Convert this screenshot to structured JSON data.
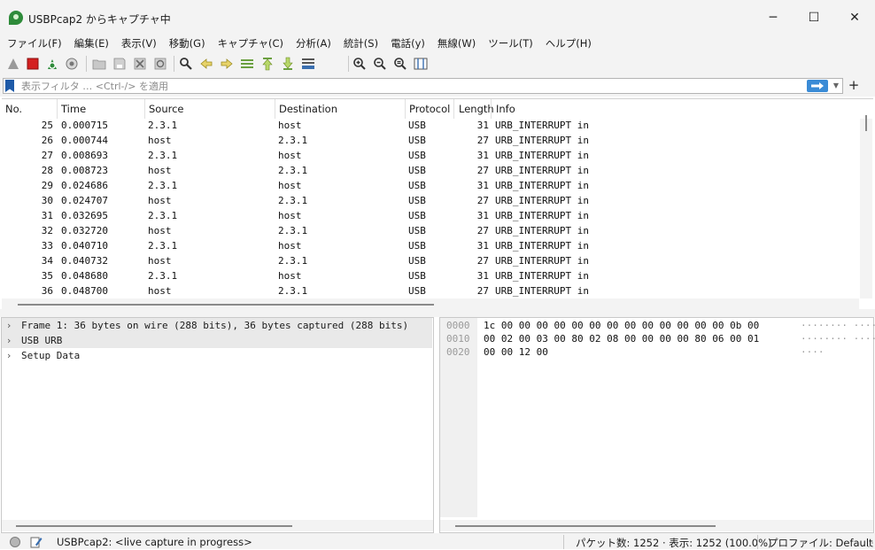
{
  "window": {
    "title": "USBPcap2 からキャプチャ中",
    "controls": {
      "minimize": "─",
      "maximize": "☐",
      "close": "✕"
    }
  },
  "menu": [
    "ファイル(F)",
    "編集(E)",
    "表示(V)",
    "移動(G)",
    "キャプチャ(C)",
    "分析(A)",
    "統計(S)",
    "電話(y)",
    "無線(W)",
    "ツール(T)",
    "ヘルプ(H)"
  ],
  "toolbar_icons": [
    "shark-fin-start-icon",
    "stop-capture-icon",
    "restart-capture-icon",
    "capture-options-icon",
    "open-file-icon",
    "save-file-icon",
    "close-file-icon",
    "reload-file-icon",
    "find-packet-icon",
    "go-back-icon",
    "go-forward-icon",
    "go-to-packet-icon",
    "first-packet-icon",
    "last-packet-icon",
    "autoscroll-icon",
    "colorize-icon",
    "zoom-in-icon",
    "zoom-out-icon",
    "zoom-reset-icon",
    "resize-columns-icon"
  ],
  "filter": {
    "placeholder": "表示フィルタ … <Ctrl-/> を適用",
    "apply_icon": "arrow-right-icon",
    "add_label": "+"
  },
  "packet_list": {
    "columns": [
      "No.",
      "Time",
      "Source",
      "Destination",
      "Protocol",
      "Length",
      "Info"
    ],
    "rows": [
      {
        "no": "25",
        "time": "0.000715",
        "src": "2.3.1",
        "dst": "host",
        "proto": "USB",
        "len": "31",
        "info": "URB_INTERRUPT in"
      },
      {
        "no": "26",
        "time": "0.000744",
        "src": "host",
        "dst": "2.3.1",
        "proto": "USB",
        "len": "27",
        "info": "URB_INTERRUPT in"
      },
      {
        "no": "27",
        "time": "0.008693",
        "src": "2.3.1",
        "dst": "host",
        "proto": "USB",
        "len": "31",
        "info": "URB_INTERRUPT in"
      },
      {
        "no": "28",
        "time": "0.008723",
        "src": "host",
        "dst": "2.3.1",
        "proto": "USB",
        "len": "27",
        "info": "URB_INTERRUPT in"
      },
      {
        "no": "29",
        "time": "0.024686",
        "src": "2.3.1",
        "dst": "host",
        "proto": "USB",
        "len": "31",
        "info": "URB_INTERRUPT in"
      },
      {
        "no": "30",
        "time": "0.024707",
        "src": "host",
        "dst": "2.3.1",
        "proto": "USB",
        "len": "27",
        "info": "URB_INTERRUPT in"
      },
      {
        "no": "31",
        "time": "0.032695",
        "src": "2.3.1",
        "dst": "host",
        "proto": "USB",
        "len": "31",
        "info": "URB_INTERRUPT in"
      },
      {
        "no": "32",
        "time": "0.032720",
        "src": "host",
        "dst": "2.3.1",
        "proto": "USB",
        "len": "27",
        "info": "URB_INTERRUPT in"
      },
      {
        "no": "33",
        "time": "0.040710",
        "src": "2.3.1",
        "dst": "host",
        "proto": "USB",
        "len": "31",
        "info": "URB_INTERRUPT in"
      },
      {
        "no": "34",
        "time": "0.040732",
        "src": "host",
        "dst": "2.3.1",
        "proto": "USB",
        "len": "27",
        "info": "URB_INTERRUPT in"
      },
      {
        "no": "35",
        "time": "0.048680",
        "src": "2.3.1",
        "dst": "host",
        "proto": "USB",
        "len": "31",
        "info": "URB_INTERRUPT in"
      },
      {
        "no": "36",
        "time": "0.048700",
        "src": "host",
        "dst": "2.3.1",
        "proto": "USB",
        "len": "27",
        "info": "URB_INTERRUPT in"
      }
    ]
  },
  "details": [
    "Frame 1: 36 bytes on wire (288 bits), 36 bytes captured (288 bits)",
    "USB URB",
    "Setup Data"
  ],
  "bytes": [
    {
      "offset": "0000",
      "hex": "1c 00 00 00 00 00 00 00  00 00 00 00 00 00 0b 00",
      "ascii": "········ ········"
    },
    {
      "offset": "0010",
      "hex": "00 02 00 03 00 80 02 08  00 00 00 00 80 06 00 01",
      "ascii": "········ ········"
    },
    {
      "offset": "0020",
      "hex": "00 00 12 00",
      "ascii": "····"
    }
  ],
  "status": {
    "capture": "USBPcap2: <live capture in progress>",
    "packets": "パケット数: 1252 · 表示: 1252 (100.0%)",
    "profile": "プロファイル: Default"
  },
  "colors": {
    "chrome": "#f3f3f3",
    "accent_blue": "#3a8bd6",
    "stop_red": "#d42020",
    "shark_green": "#2e8b3a"
  }
}
